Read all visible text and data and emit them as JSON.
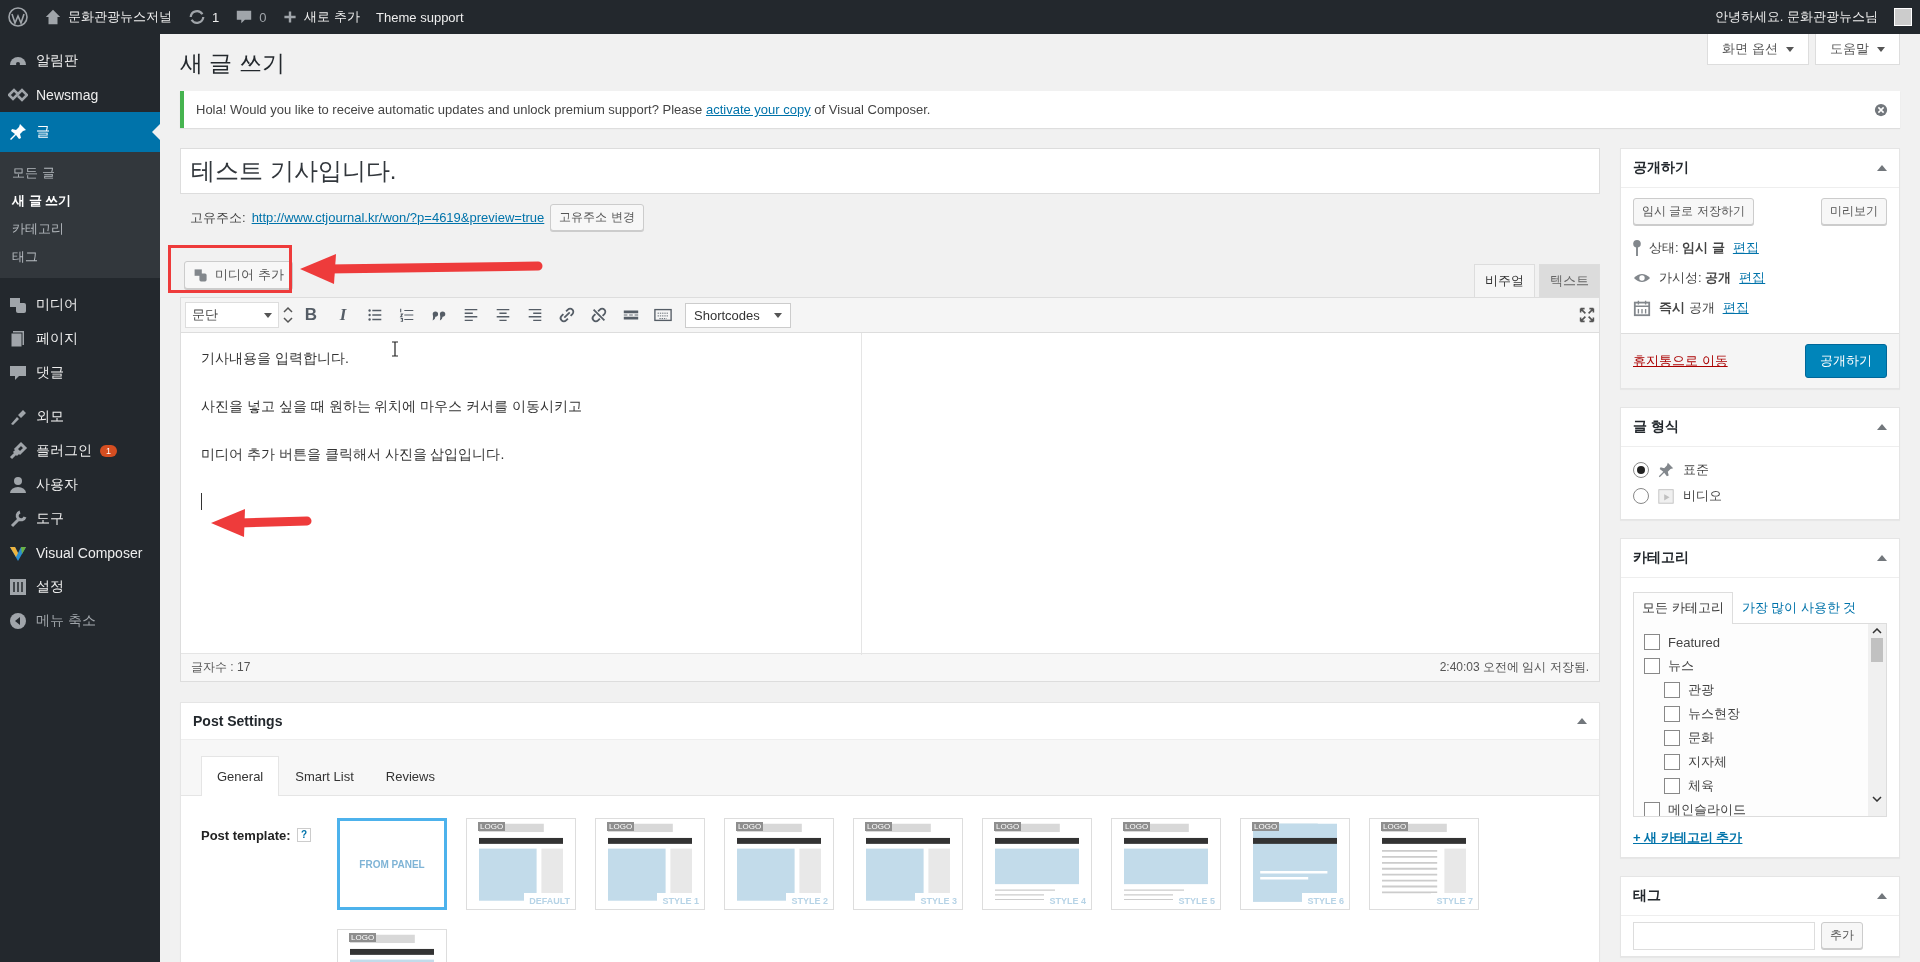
{
  "admin_bar": {
    "site_name": "문화관광뉴스저널",
    "updates": "1",
    "comments": "0",
    "new_label": "새로 추가",
    "theme_support": "Theme support",
    "greeting": "안녕하세요. 문화관광뉴스님"
  },
  "sidebar": {
    "items": [
      {
        "label": "알림판",
        "kind": "dashboard",
        "selected": false
      },
      {
        "label": "Newsmag",
        "kind": "diamond",
        "selected": false
      },
      {
        "label": "글",
        "kind": "pin",
        "selected": true,
        "children": [
          {
            "label": "모든 글",
            "selected": false
          },
          {
            "label": "새 글 쓰기",
            "selected": true
          },
          {
            "label": "카테고리",
            "selected": false
          },
          {
            "label": "태그",
            "selected": false
          }
        ]
      },
      {
        "label": "미디어",
        "kind": "media",
        "selected": false
      },
      {
        "label": "페이지",
        "kind": "page",
        "selected": false
      },
      {
        "label": "댓글",
        "kind": "comment",
        "selected": false
      },
      {
        "label": "외모",
        "kind": "brush",
        "selected": false
      },
      {
        "label": "플러그인",
        "kind": "plug",
        "selected": false,
        "badge": "1"
      },
      {
        "label": "사용자",
        "kind": "user",
        "selected": false
      },
      {
        "label": "도구",
        "kind": "wrench",
        "selected": false
      },
      {
        "label": "Visual Composer",
        "kind": "vc",
        "selected": false
      },
      {
        "label": "설정",
        "kind": "sliders",
        "selected": false
      }
    ],
    "collapse": "메뉴 축소"
  },
  "screen_options": "화면 옵션",
  "help": "도움말",
  "page_title": "새 글 쓰기",
  "notice": {
    "before": "Hola! Would you like to receive automatic updates and unlock premium support? Please",
    "link": "activate your copy",
    "after": "of Visual Composer."
  },
  "post_title": "테스트 기사입니다.",
  "permalink": {
    "label": "고유주소:",
    "url": "http://www.ctjournal.kr/won/?p=4619&preview=true",
    "button": "고유주소 변경"
  },
  "media_button": "미디어 추가",
  "editor_tabs": [
    {
      "label": "비주얼",
      "selected": true
    },
    {
      "label": "텍스트",
      "selected": false
    }
  ],
  "toolbar": {
    "format": "문단",
    "buttons": [
      {
        "kind": "bold",
        "label": "B"
      },
      {
        "kind": "italic",
        "label": "I"
      },
      {
        "kind": "ul"
      },
      {
        "kind": "ol"
      },
      {
        "kind": "quote"
      },
      {
        "kind": "left"
      },
      {
        "kind": "center"
      },
      {
        "kind": "right"
      },
      {
        "kind": "link"
      },
      {
        "kind": "unlink"
      },
      {
        "kind": "more"
      },
      {
        "kind": "keyboard"
      }
    ],
    "shortcodes": "Shortcodes"
  },
  "content": [
    "기사내용을 입력합니다.",
    "사진을 넣고 싶을 때 원하는 위치에 마우스 커서를 이동시키고",
    "미디어 추가 버튼을 클릭해서 사진을 삽입입니다."
  ],
  "word_count": "글자수 : 17",
  "autosave": "2:40:03 오전에 임시 저장됨.",
  "post_settings": {
    "title": "Post Settings",
    "tabs": [
      {
        "label": "General",
        "selected": true
      },
      {
        "label": "Smart List",
        "selected": false
      },
      {
        "label": "Reviews",
        "selected": false
      }
    ],
    "template_label": "Post template:",
    "help": "?",
    "templates": [
      {
        "kind": "panel",
        "label": "FROM PANEL",
        "selected": true
      },
      {
        "kind": "sidebar",
        "logo": "LOGO",
        "label": "DEFAULT",
        "selected": false
      },
      {
        "kind": "sidebar",
        "logo": "LOGO",
        "label": "STYLE 1",
        "selected": false
      },
      {
        "kind": "sidebar",
        "logo": "LOGO",
        "label": "STYLE 2",
        "selected": false
      },
      {
        "kind": "sidebar",
        "logo": "LOGO",
        "label": "STYLE 3",
        "selected": false
      },
      {
        "kind": "wide",
        "logo": "LOGO",
        "label": "STYLE 4",
        "selected": false
      },
      {
        "kind": "wide",
        "logo": "LOGO",
        "label": "STYLE 5",
        "selected": false
      },
      {
        "kind": "overlay",
        "logo": "LOGO",
        "label": "STYLE 6",
        "selected": false
      },
      {
        "kind": "text",
        "logo": "LOGO",
        "label": "STYLE 7",
        "selected": false
      },
      {
        "kind": "wide",
        "logo": "LOGO",
        "selected": false
      }
    ]
  },
  "publish": {
    "title": "공개하기",
    "save_draft": "임시 글로 저장하기",
    "preview": "미리보기",
    "rows": [
      {
        "kind": "pin",
        "text": "상태: **임시 글**",
        "link": "편집"
      },
      {
        "kind": "eye",
        "text": "가시성: **공개**",
        "link": "편집"
      },
      {
        "kind": "calendar",
        "text": "**즉시** 공개",
        "link": "편집"
      }
    ],
    "trash": "휴지통으로 이동",
    "publish": "공개하기"
  },
  "format": {
    "title": "글 형식",
    "options": [
      {
        "kind": "standard",
        "label": "표준",
        "selected": true
      },
      {
        "kind": "video",
        "label": "비디오",
        "selected": false
      }
    ]
  },
  "categories": {
    "title": "카테고리",
    "tabs": [
      {
        "label": "모든 카테고리",
        "selected": true
      },
      {
        "label": "가장 많이 사용한 것",
        "selected": false
      }
    ],
    "items": [
      {
        "label": "Featured",
        "checked": false
      },
      {
        "label": "뉴스",
        "checked": false,
        "children": [
          {
            "label": "관광",
            "checked": false
          },
          {
            "label": "뉴스현장",
            "checked": false
          },
          {
            "label": "문화",
            "checked": false
          },
          {
            "label": "지자체",
            "checked": false
          },
          {
            "label": "체육",
            "checked": false
          }
        ]
      },
      {
        "label": "메인슬라이드",
        "checked": false
      }
    ],
    "add": "+ 새 카테고리 추가"
  },
  "tags": {
    "title": "태그",
    "button": "추가"
  }
}
